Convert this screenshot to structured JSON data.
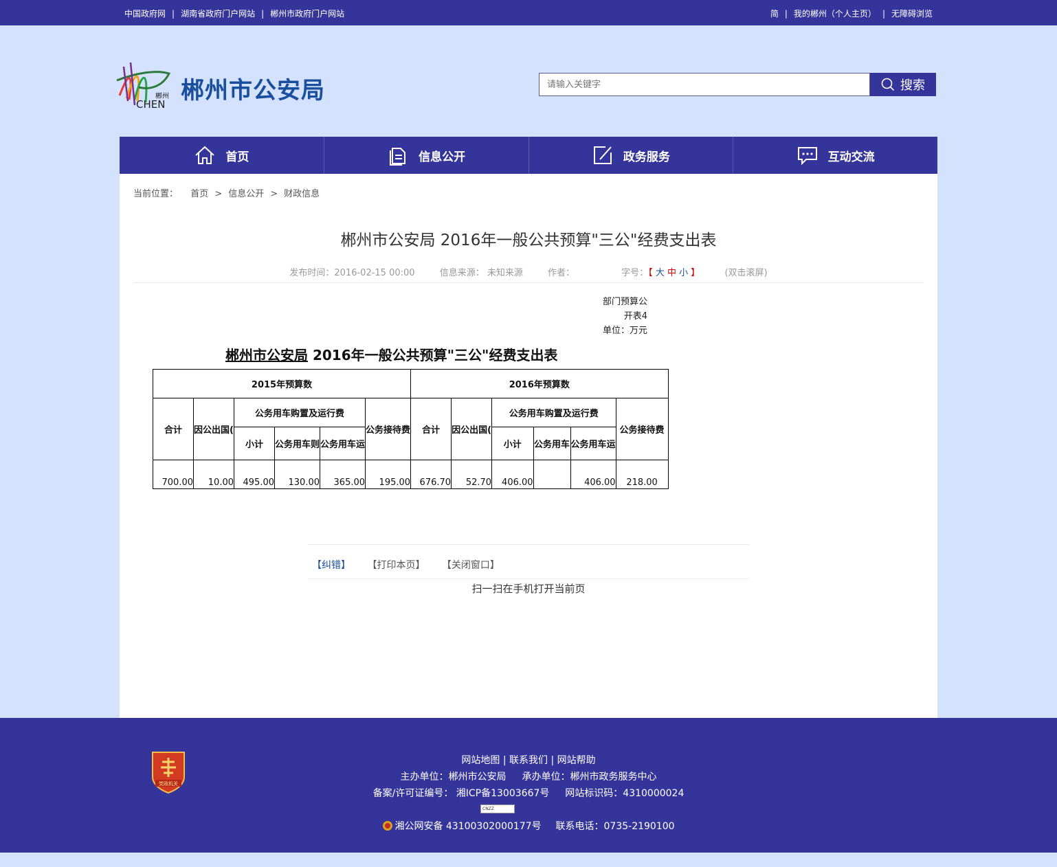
{
  "topbar": {
    "left_links": [
      "中国政府网",
      "湖南省政府门户网站",
      "郴州市政府门户网站"
    ],
    "right_links": [
      "简",
      "我的郴州（个人主页）",
      "无障碍浏览"
    ]
  },
  "header": {
    "logo_small_text": "郴州",
    "logo_latin": "CHEN",
    "site_name": "郴州市公安局",
    "search_placeholder": "请输入关键字",
    "search_label": "搜索"
  },
  "nav": [
    {
      "label": "首页",
      "icon": "home-icon"
    },
    {
      "label": "信息公开",
      "icon": "document-icon"
    },
    {
      "label": "政务服务",
      "icon": "edit-icon"
    },
    {
      "label": "互动交流",
      "icon": "chat-icon"
    }
  ],
  "breadcrumb": {
    "prefix": "当前位置：",
    "items": [
      "首页",
      "信息公开",
      "财政信息"
    ],
    "separator": ">"
  },
  "article": {
    "title": "郴州市公安局 2016年一般公共预算\"三公\"经费支出表",
    "meta": {
      "published": "发布时间：2016-02-15 00:00",
      "source": "信息来源： 未知来源",
      "author": "作者：",
      "font_size_label": "字号：",
      "bracket_open": "【",
      "size_big": "大",
      "size_mid": "中",
      "size_small": "小",
      "bracket_close": "】",
      "dblclick": "(双击滚屏)"
    },
    "note_line1": "部门预算公",
    "note_line2": "开表4",
    "unit": "单位：万元",
    "table_title_part1": "郴州市公安局",
    "table_title_part2": " 2016年一般公共预算\"三公\"经费支出表"
  },
  "table": {
    "year_2015": "2015年预算数",
    "year_2016": "2016年预算数",
    "col_total": "合计",
    "col_abroad": "因公出国(",
    "col_abroad_2016": "因公出国(",
    "col_vehicle": "公务用车购置及运行费",
    "col_subtotal": "小计",
    "col_vehicle_buy": "公务用车则",
    "col_vehicle_run": "公务用车运",
    "col_vehicle_buy_2016": "公务用车",
    "col_vehicle_run_2016": "公务用车运",
    "col_reception": "公务接待费",
    "col_reception_2016": "公务接待费",
    "values_2015": [
      "700.00",
      "10.00",
      "495.00",
      "130.00",
      "365.00",
      "195.00"
    ],
    "values_2016": [
      "676.70",
      "52.70",
      "406.00",
      "",
      "406.00",
      "218.00"
    ]
  },
  "actions": {
    "correct": "【纠错】",
    "print": "【打印本页】",
    "close": "【关闭窗口】",
    "qr": "扫一扫在手机打开当前页"
  },
  "footer": {
    "links": [
      "网站地图",
      "联系我们",
      "网站帮助"
    ],
    "sponsor": "主办单位：郴州市公安局",
    "organizer": "承办单位：郴州市政务服务中心",
    "icp": "备案/许可证编号： 湘ICP备13003667号",
    "site_code": "网站标识码：4310000024",
    "cnzz": "CNZZ",
    "police": "湘公网安备 43100302000177号",
    "phone": "联系电话：0735-2190100",
    "badge_text": "党政机关"
  },
  "colors": {
    "brand": "#35349a",
    "page_bg": "#d4e2fd",
    "title_blue": "#1a4f9e"
  }
}
